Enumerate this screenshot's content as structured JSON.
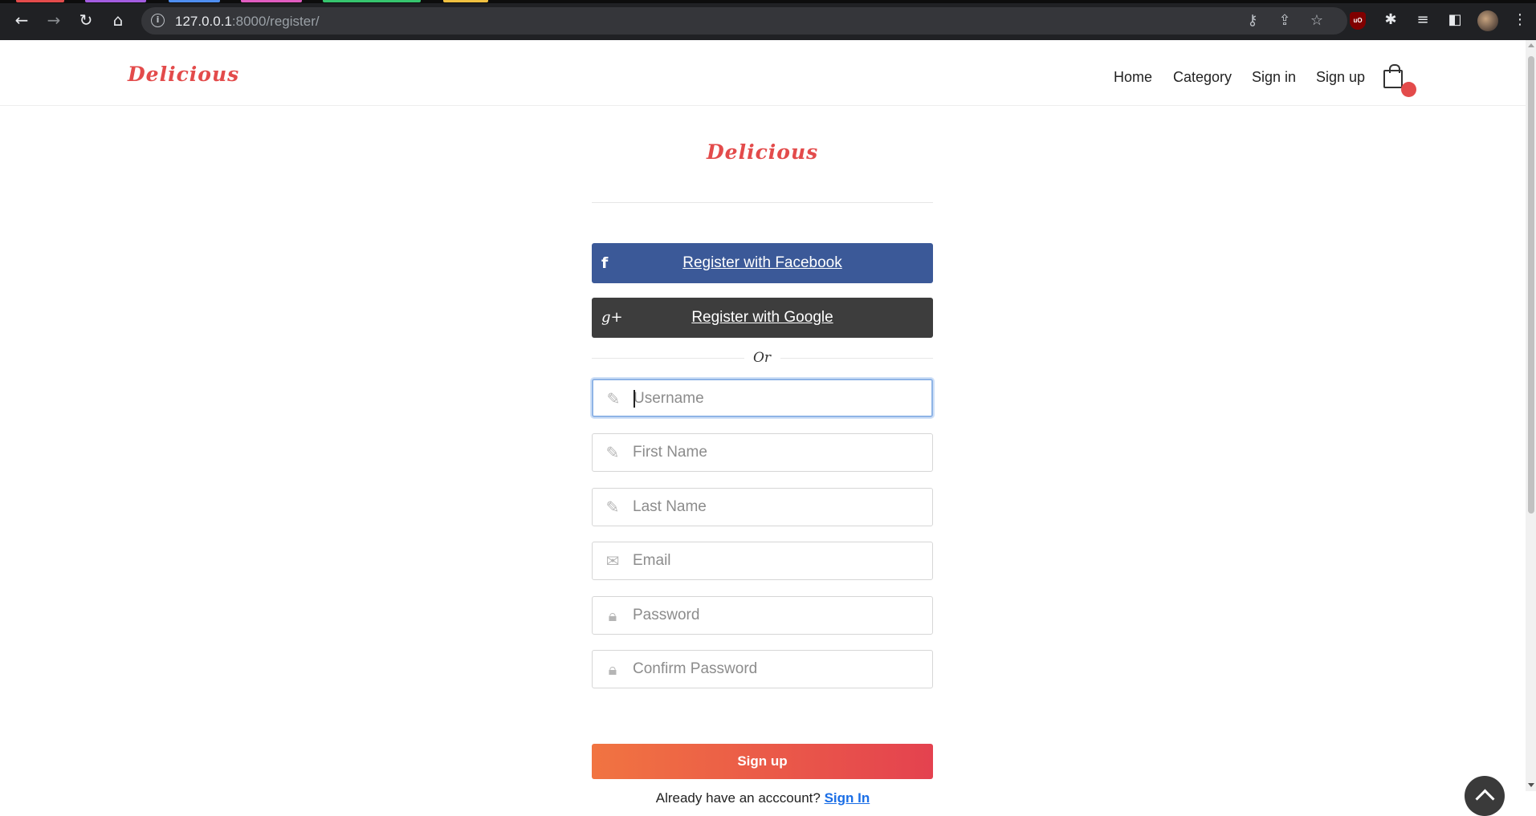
{
  "browser": {
    "url_host": "127.0.0.1",
    "url_path": ":8000/register/",
    "tab_colors": [
      "#e34b4b",
      "#a35ce0",
      "#4e8ef0",
      "#e05cc0",
      "#36c46e",
      "#f0c040"
    ]
  },
  "header": {
    "brand": "Delicious",
    "nav": [
      "Home",
      "Category",
      "Sign in",
      "Sign up"
    ],
    "cart_icon": "shopping-bag-icon"
  },
  "form": {
    "brand": "Delicious",
    "facebook_label": "Register with Facebook",
    "facebook_icon": "f",
    "google_label": "Register with Google",
    "google_icon": "g+",
    "or_text": "Or",
    "fields": [
      {
        "placeholder": "Username",
        "icon": "pencil-icon"
      },
      {
        "placeholder": "First Name",
        "icon": "pencil-icon"
      },
      {
        "placeholder": "Last Name",
        "icon": "pencil-icon"
      },
      {
        "placeholder": "Email",
        "icon": "envelope-icon"
      },
      {
        "placeholder": "Password",
        "icon": "lock-icon"
      },
      {
        "placeholder": "Confirm Password",
        "icon": "lock-icon"
      }
    ],
    "submit_label": "Sign up",
    "signin_prompt": "Already have an acccount?",
    "signin_link": "Sign In"
  },
  "colors": {
    "brand": "#e34b4b",
    "facebook": "#3b5998",
    "google": "#3d3d3d",
    "submit_gradient_start": "#f17441",
    "submit_gradient_end": "#e4424f",
    "link": "#1a6ee6"
  }
}
